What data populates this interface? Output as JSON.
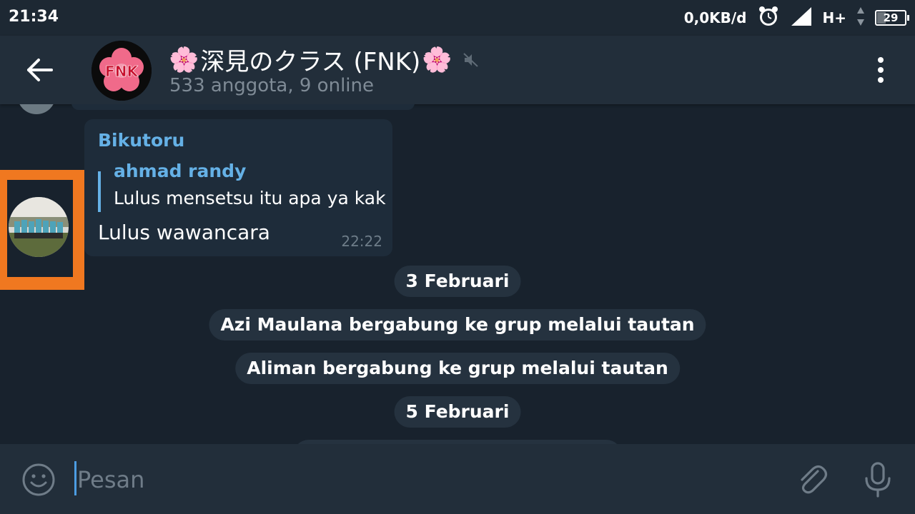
{
  "status_bar": {
    "time": "21:34",
    "network_speed": "0,0KB/d",
    "network_type": "H+",
    "battery_level": "29",
    "battery_percent": 29,
    "icons": [
      "alarm-icon",
      "signal-icon",
      "data-arrows-icon",
      "battery-icon"
    ]
  },
  "header": {
    "title_prefix_emoji": "🌸",
    "title": "深見のクラス (FNK)",
    "title_suffix_emoji": "🌸",
    "avatar_text": "FNK",
    "subtitle": "533 anggota, 9 online",
    "muted": true,
    "icons": [
      "back-arrow-icon",
      "mute-icon",
      "more-vert-icon"
    ]
  },
  "message": {
    "sender": "Bikutoru",
    "reply_to_name": "ahmad randy",
    "reply_to_text": "Lulus mensetsu itu apa ya kak",
    "text": "Lulus wawancara",
    "time": "22:22"
  },
  "service_messages": [
    {
      "text": "3 Februari"
    },
    {
      "text": "Azi Maulana bergabung ke grup melalui tautan"
    },
    {
      "text": "Aliman bergabung ke grup melalui tautan"
    },
    {
      "text": "5 Februari"
    }
  ],
  "composer": {
    "placeholder": "Pesan",
    "icons": [
      "emoji-icon",
      "attach-icon",
      "mic-icon"
    ]
  },
  "colors": {
    "background": "#18222d",
    "header": "#222e3a",
    "bubble": "#1e2c3a",
    "accent": "#65b1e6",
    "highlight": "#f07820"
  }
}
